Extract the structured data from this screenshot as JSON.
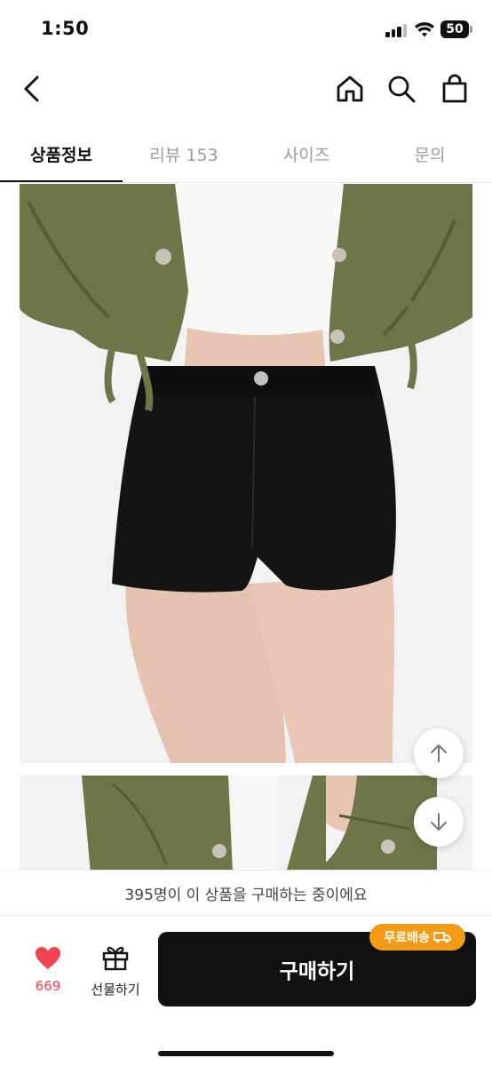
{
  "status_bar": {
    "time": "1:50",
    "battery": "50"
  },
  "nav": {
    "icons": [
      "back-icon",
      "home-icon",
      "search-icon",
      "shopping-bag-icon"
    ]
  },
  "tabs": [
    {
      "label": "상품정보",
      "active": true
    },
    {
      "label": "리뷰 153",
      "active": false
    },
    {
      "label": "사이즈",
      "active": false
    },
    {
      "label": "문의",
      "active": false
    }
  ],
  "banner": {
    "text": "395명이 이 상품을 구매하는 중이에요"
  },
  "bottom_bar": {
    "like_count": "669",
    "gift_label": "선물하기",
    "buy_label": "구매하기",
    "free_shipping_badge": "무료배송"
  },
  "colors": {
    "accent_like": "#f04452",
    "free_shipping_badge": "#f39b14",
    "buy_button": "#111111"
  }
}
